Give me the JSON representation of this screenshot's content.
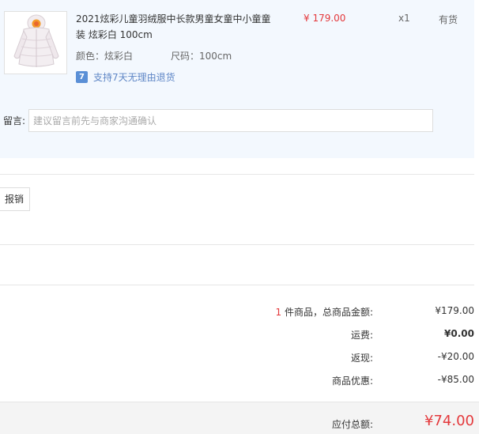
{
  "item": {
    "title": "2021炫彩儿童羽绒服中长款男童女童中小童童装 炫彩白 100cm",
    "price": "¥ 179.00",
    "quantity": "x1",
    "stock": "有货",
    "attr_color": "颜色：炫彩白",
    "attr_size": "尺码：100cm",
    "return_badge": "7",
    "return_policy": "支持7天无理由退货"
  },
  "note": {
    "label": "留言:",
    "placeholder": "建议留言前先与商家沟通确认"
  },
  "invoice": {
    "button_label": "报销"
  },
  "summary": {
    "count": "1",
    "count_suffix": " 件商品，总商品金额:",
    "goods_total": "¥179.00",
    "shipping_label": "运费:",
    "shipping_value": "¥0.00",
    "cashback_label": "返现:",
    "cashback_value": "-¥20.00",
    "discount_label": "商品优惠:",
    "discount_value": "-¥85.00",
    "payable_label": "应付总额:",
    "payable_value": "¥74.00"
  },
  "colors": {
    "accent_red": "#e4393c",
    "item_bg": "#f3f8fe",
    "link_blue": "#5e86c6"
  }
}
